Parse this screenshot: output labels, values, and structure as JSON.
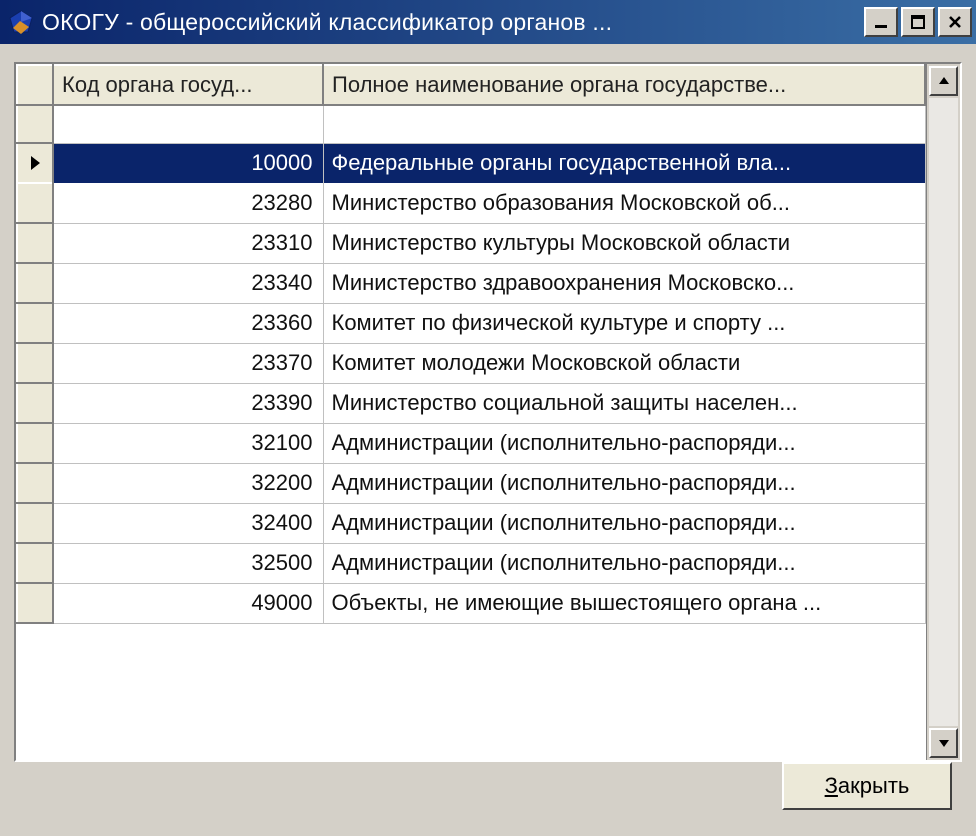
{
  "window": {
    "title": "ОКОГУ - общероссийский классификатор органов ..."
  },
  "columns": {
    "code": "Код органа госуд...",
    "name": "Полное наименование органа государстве..."
  },
  "selected_index": 0,
  "rows": [
    {
      "code": "10000",
      "name": "Федеральные органы государственной вла..."
    },
    {
      "code": "23280",
      "name": "Министерство образования Московской об..."
    },
    {
      "code": "23310",
      "name": "Министерство культуры Московской области"
    },
    {
      "code": "23340",
      "name": "Министерство здравоохранения Московско..."
    },
    {
      "code": "23360",
      "name": "Комитет по физической культуре и спорту ..."
    },
    {
      "code": "23370",
      "name": "Комитет молодежи Московской области"
    },
    {
      "code": "23390",
      "name": "Министерство социальной защиты населен..."
    },
    {
      "code": "32100",
      "name": "Администрации (исполнительно-распоряди..."
    },
    {
      "code": "32200",
      "name": "Администрации (исполнительно-распоряди..."
    },
    {
      "code": "32400",
      "name": "Администрации (исполнительно-распоряди..."
    },
    {
      "code": "32500",
      "name": "Администрации (исполнительно-распоряди..."
    },
    {
      "code": "49000",
      "name": "Объекты, не имеющие вышестоящего органа ..."
    }
  ],
  "buttons": {
    "close_prefix": "З",
    "close_rest": "акрыть"
  }
}
